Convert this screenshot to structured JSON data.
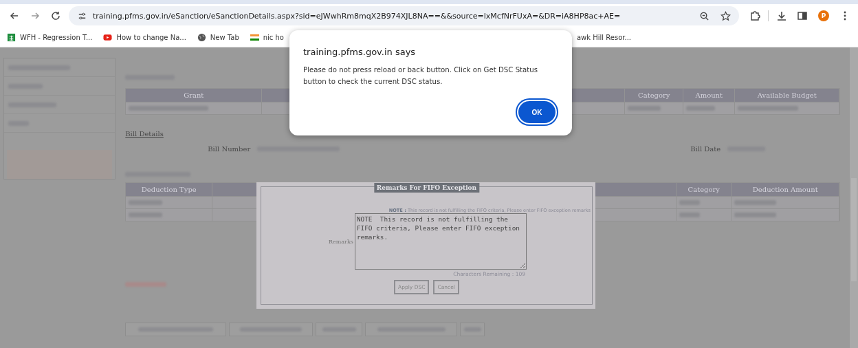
{
  "browser": {
    "url": "training.pfms.gov.in/eSanction/eSanctionDetails.aspx?sid=eJWwhRm8mqX2B974XJL8NA==&&source=lxMcfNrFUxA=&DR=iA8HP8ac+AE=",
    "profile": "P",
    "bookmarks": [
      {
        "label": "WFH - Regression T...",
        "kind": "sheets"
      },
      {
        "label": "How to change Na...",
        "kind": "video"
      },
      {
        "label": "New Tab",
        "kind": "globe"
      },
      {
        "label": "nic ho",
        "kind": "flag"
      }
    ],
    "bookmark_partial": "awk Hill Resor..."
  },
  "alert": {
    "title": "training.pfms.gov.in says",
    "message": "Please do not press reload or back button. Click on Get DSC Status button to check the current DSC status.",
    "ok": "OK"
  },
  "accrual_table": {
    "columns": [
      "Grant",
      "",
      "Category",
      "Amount",
      "Available Budget"
    ]
  },
  "bill": {
    "heading": "Bill Details",
    "number_label": "Bill Number",
    "date_label": "Bill Date"
  },
  "deduction_table": {
    "columns": [
      "Deduction Type",
      "",
      "",
      "Category",
      "Deduction Amount"
    ]
  },
  "modal": {
    "title": "Remarks For FIFO Exception",
    "note_label": "NOTE :",
    "note_text": "This record is not fulfilling the FIFO criteria, Please enter FIFO exception remarks",
    "remarks_label": "Remarks",
    "remarks_value": "NOTE  This record is not fulfilling the FIFO criteria, Please enter FIFO exception remarks.",
    "chars_remaining": "Characters Remaining : 109",
    "buttons": [
      "Apply DSC",
      "Cancel"
    ]
  }
}
